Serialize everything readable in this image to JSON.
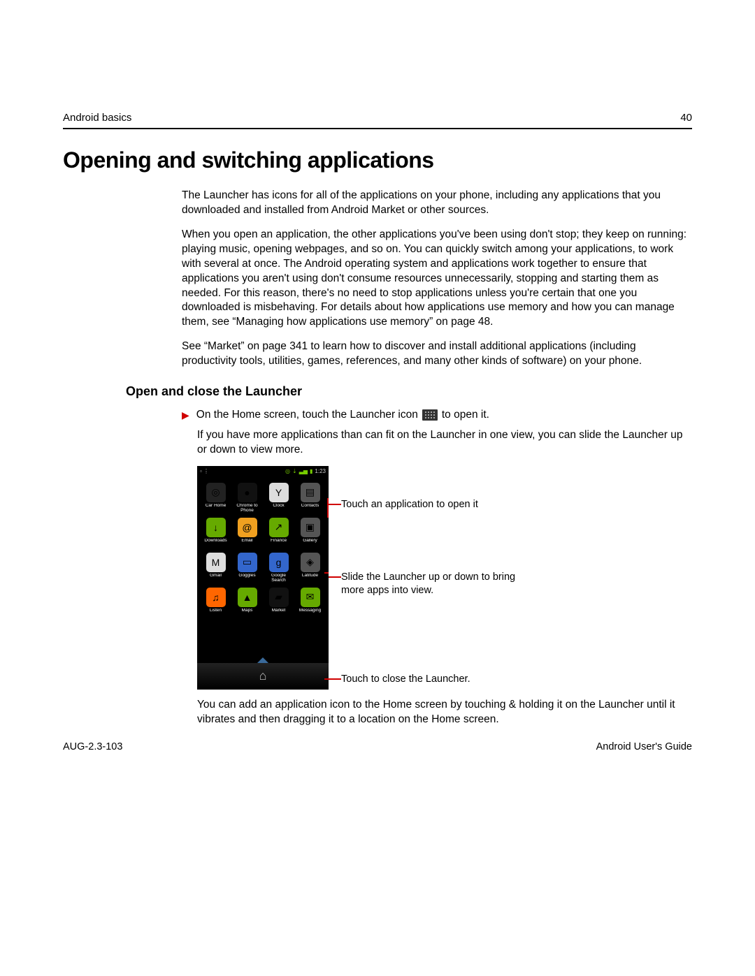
{
  "runningHead": {
    "section": "Android basics",
    "pageNum": "40"
  },
  "title": "Opening and switching applications",
  "intro": [
    "The Launcher has icons for all of the applications on your phone, including any applications that you downloaded and installed from Android Market or other sources.",
    "When you open an application, the other applications you've been using don't stop; they keep on running: playing music, opening webpages, and so on. You can quickly switch among your applications, to work with several at once. The Android operating system and applications work together to ensure that applications you aren't using don't consume resources unnecessarily, stopping and starting them as needed. For this reason, there's no need to stop applications unless you're certain that one you downloaded is misbehaving. For details about how applications use memory and how you can manage them, see “Managing how applications use memory” on page 48.",
    "See “Market” on page 341 to learn how to discover and install additional applications (including productivity tools, utilities, games, references, and many other kinds of software) on your phone."
  ],
  "subhead": "Open and close the Launcher",
  "step": {
    "pre": "On the Home screen, touch the Launcher icon",
    "post": "to open it."
  },
  "stepBody": [
    "If you have more applications than can fit on the Launcher in one view, you can slide the Launcher up or down to view more.",
    "You can add an application icon to the Home screen by touching & holding it on the Launcher until it vibrates and then dragging it to a location on the Home screen."
  ],
  "phone": {
    "time": "1:23",
    "apps": [
      {
        "label": "Car Home",
        "cls": "ic-blk",
        "glyph": "◎"
      },
      {
        "label": "Chrome to Phone",
        "cls": "ic-drk",
        "glyph": "●"
      },
      {
        "label": "Clock",
        "cls": "ic-wht",
        "glyph": "Y"
      },
      {
        "label": "Contacts",
        "cls": "ic-gry",
        "glyph": "▤"
      },
      {
        "label": "Downloads",
        "cls": "ic-grn",
        "glyph": "↓"
      },
      {
        "label": "Email",
        "cls": "ic-ylw",
        "glyph": "@"
      },
      {
        "label": "Finance",
        "cls": "ic-grn",
        "glyph": "↗"
      },
      {
        "label": "Gallery",
        "cls": "ic-gry",
        "glyph": "▣"
      },
      {
        "label": "Gmail",
        "cls": "ic-wht",
        "glyph": "M"
      },
      {
        "label": "Goggles",
        "cls": "ic-blu",
        "glyph": "▭"
      },
      {
        "label": "Google Search",
        "cls": "ic-blu",
        "glyph": "g"
      },
      {
        "label": "Latitude",
        "cls": "ic-gry",
        "glyph": "◈"
      },
      {
        "label": "Listen",
        "cls": "ic-org",
        "glyph": "♫"
      },
      {
        "label": "Maps",
        "cls": "ic-grn",
        "glyph": "▲"
      },
      {
        "label": "Market",
        "cls": "ic-drk",
        "glyph": "▰"
      },
      {
        "label": "Messaging",
        "cls": "ic-grn",
        "glyph": "✉"
      }
    ]
  },
  "callouts": {
    "c1": "Touch an application to open it",
    "c2": "Slide the Launcher up or down to bring more apps into view.",
    "c3": "Touch to close the Launcher."
  },
  "footer": {
    "left": "AUG-2.3-103",
    "right": "Android User's Guide"
  }
}
